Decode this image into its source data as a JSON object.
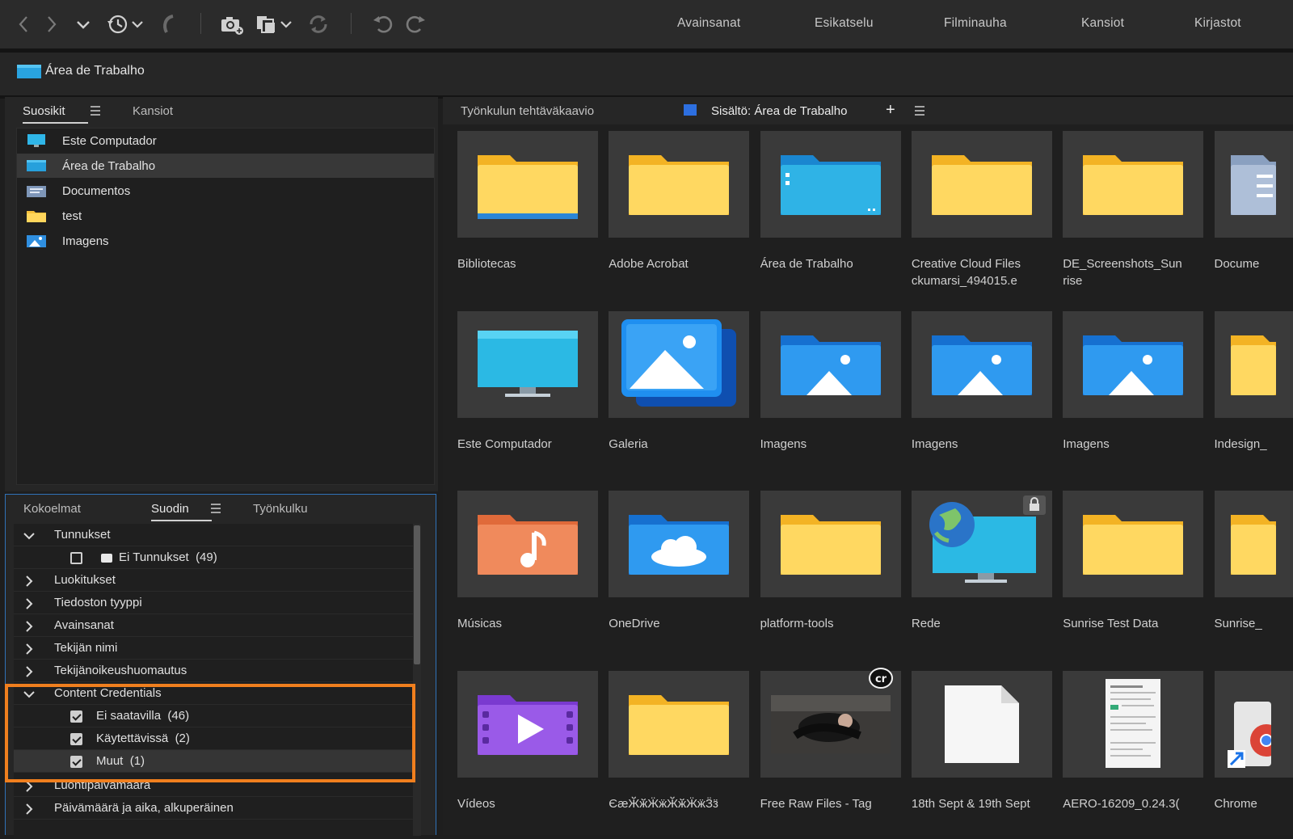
{
  "toolbar": {
    "workspaces": [
      "Avainsanat",
      "Esikatselu",
      "Filminauha",
      "Kansiot",
      "Kirjastot"
    ]
  },
  "path": {
    "label": "Área de Trabalho"
  },
  "favorites_panel": {
    "tabs": [
      "Suosikit",
      "Kansiot"
    ],
    "items": [
      {
        "label": "Este Computador",
        "icon": "monitor-icon"
      },
      {
        "label": "Área de Trabalho",
        "icon": "desktop-icon"
      },
      {
        "label": "Documentos",
        "icon": "documents-icon"
      },
      {
        "label": "test",
        "icon": "folder-icon"
      },
      {
        "label": "Imagens",
        "icon": "pictures-icon"
      }
    ]
  },
  "filter_panel": {
    "tabs": [
      "Kokoelmat",
      "Suodin",
      "Työnkulku"
    ],
    "rows": [
      {
        "label": "Tunnukset"
      },
      {
        "label": "Ei Tunnukset",
        "count": "(49)"
      },
      {
        "label": "Luokitukset"
      },
      {
        "label": "Tiedoston tyyppi"
      },
      {
        "label": "Avainsanat"
      },
      {
        "label": "Tekijän nimi"
      },
      {
        "label": "Tekijänoikeushuomautus"
      },
      {
        "label": "Content Credentials"
      },
      {
        "label": "Ei saatavilla",
        "count": "(46)"
      },
      {
        "label": "Käytettävissä",
        "count": "(2)"
      },
      {
        "label": "Muut",
        "count": "(1)"
      },
      {
        "label": "Luontipäivämäärä"
      },
      {
        "label": "Päivämäärä ja aika, alkuperäinen"
      }
    ]
  },
  "content_panel": {
    "tabs": {
      "workflow": "Työnkulun tehtäväkaavio",
      "content": "Sisältö: Área de Trabalho",
      "add": "+"
    },
    "items": [
      {
        "name": "Bibliotecas",
        "kind": "folder-library"
      },
      {
        "name": "Adobe Acrobat",
        "kind": "folder"
      },
      {
        "name": "Área de Trabalho",
        "kind": "folder-desktop"
      },
      {
        "name": "Creative Cloud Files\nckumarsi_494015.e",
        "kind": "folder"
      },
      {
        "name": "DE_Screenshots_Sun\nrise",
        "kind": "folder"
      },
      {
        "name": "Docume",
        "kind": "documents-partial"
      },
      {
        "name": "Este Computador",
        "kind": "monitor"
      },
      {
        "name": "Galeria",
        "kind": "gallery"
      },
      {
        "name": "Imagens",
        "kind": "pictures"
      },
      {
        "name": "Imagens",
        "kind": "pictures"
      },
      {
        "name": "Imagens",
        "kind": "pictures"
      },
      {
        "name": "Indesign_",
        "kind": "folder-partial"
      },
      {
        "name": "Músicas",
        "kind": "music"
      },
      {
        "name": "OneDrive",
        "kind": "onedrive"
      },
      {
        "name": "platform-tools",
        "kind": "folder"
      },
      {
        "name": "Rede",
        "kind": "network",
        "badge": "lock"
      },
      {
        "name": "Sunrise Test Data",
        "kind": "folder"
      },
      {
        "name": "Sunrise_",
        "kind": "folder-partial"
      },
      {
        "name": "Vídeos",
        "kind": "videos"
      },
      {
        "name": "ЄӕӁӂӜӝӁӂӜӝӞӟ",
        "kind": "folder"
      },
      {
        "name": "Free Raw Files - Tag",
        "kind": "photo",
        "badge": "cr"
      },
      {
        "name": "18th Sept & 19th Sept",
        "kind": "blank-file"
      },
      {
        "name": "AERO-16209_0.24.3(",
        "kind": "document"
      },
      {
        "name": "Chrome",
        "kind": "shortcut-chrome"
      }
    ]
  }
}
